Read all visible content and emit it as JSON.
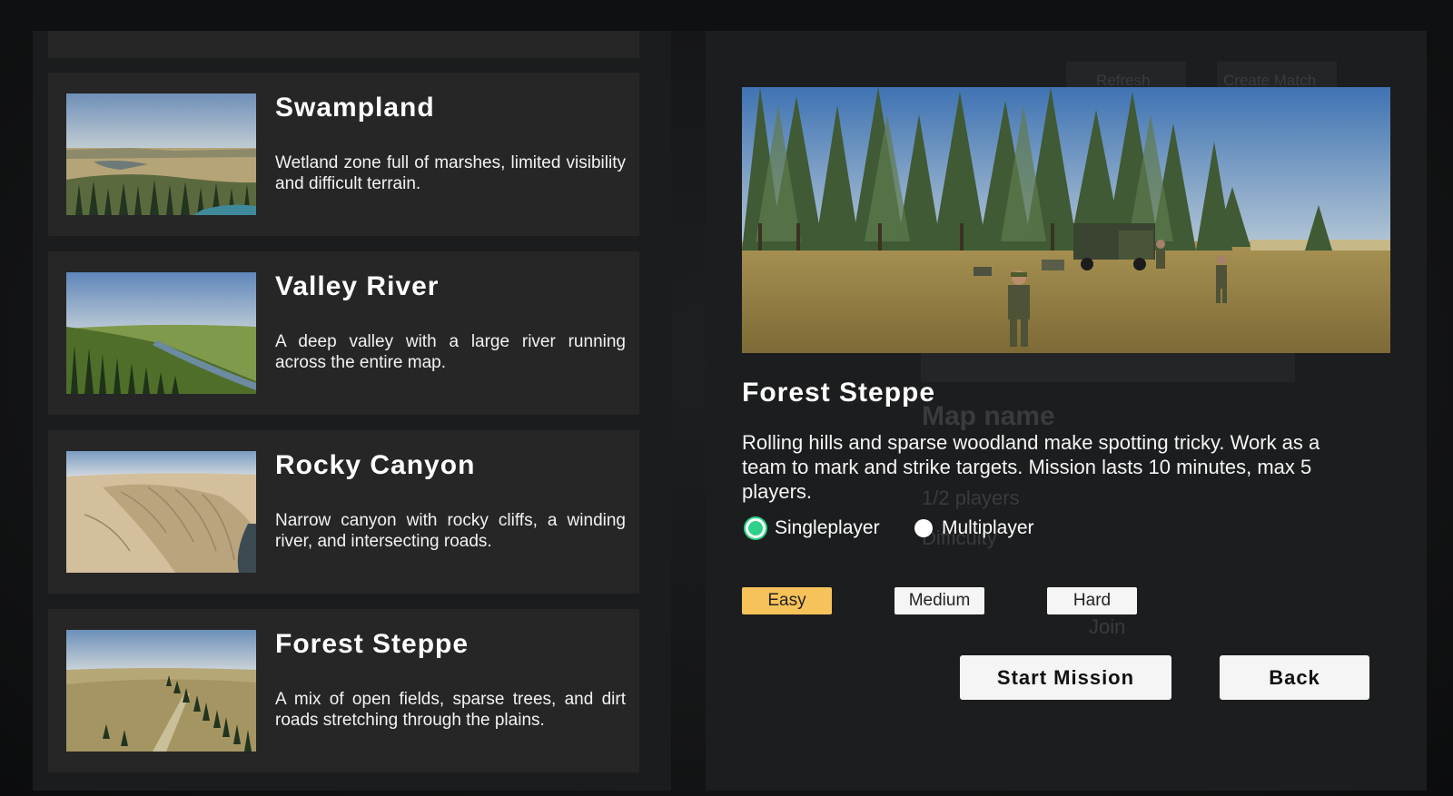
{
  "maps": [
    {
      "name": "Swampland",
      "description": "Wetland zone full of marshes, limited visibility and difficult terrain."
    },
    {
      "name": "Valley River",
      "description": "A deep valley with a large river running across the entire map."
    },
    {
      "name": "Rocky Canyon",
      "description": "Narrow canyon with rocky cliffs, a winding river, and intersecting roads."
    },
    {
      "name": "Forest Steppe",
      "description": "A mix of open fields, sparse trees, and dirt roads stretching through the plains."
    }
  ],
  "detail": {
    "title": "Forest Steppe",
    "description": "Rolling hills and sparse woodland make spotting tricky. Work as a team to mark and strike targets. Mission lasts 10 minutes, max 5 players.",
    "modes": [
      {
        "label": "Singleplayer",
        "selected": true
      },
      {
        "label": "Multiplayer",
        "selected": false
      }
    ],
    "difficulties": [
      {
        "label": "Easy",
        "selected": true
      },
      {
        "label": "Medium",
        "selected": false
      },
      {
        "label": "Hard",
        "selected": false
      }
    ],
    "start_label": "Start Mission",
    "back_label": "Back"
  },
  "background_ghost": {
    "refresh": "Refresh",
    "create_match": "Create Match",
    "map_name": "Map name",
    "players": "1/2 players",
    "difficulty": "Difficulty",
    "join": "Join"
  },
  "colors": {
    "selected_difficulty": "#f6c25a",
    "radio_on": "#2fd18a",
    "card_bg": "#262626",
    "panel_bg": "#1c1d1e"
  }
}
